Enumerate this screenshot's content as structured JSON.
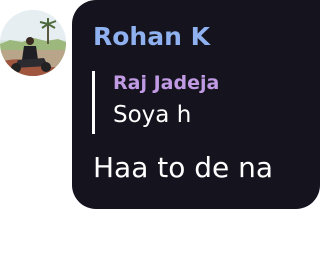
{
  "message": {
    "sender": "Rohan K",
    "reply_to": {
      "name": "Raj Jadeja",
      "text": "Soya h"
    },
    "text": "Haa to de na"
  },
  "colors": {
    "bubble_background": "#15131e",
    "sender_name": "#8fb1ef",
    "reply_name": "#c09be4",
    "message_text": "#ffffff"
  }
}
